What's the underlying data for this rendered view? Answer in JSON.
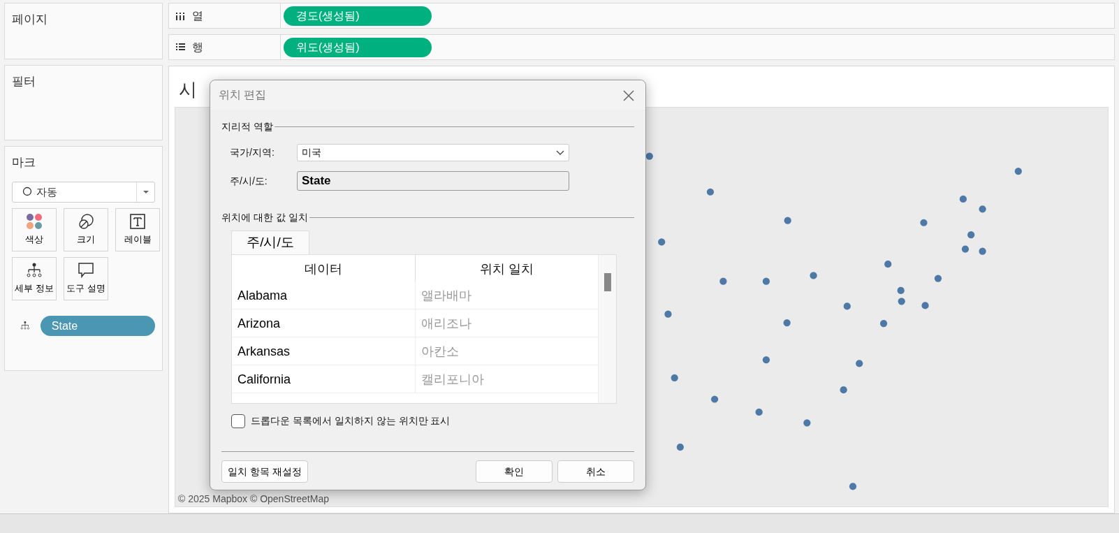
{
  "side_panels": [
    {
      "title": "페이지"
    },
    {
      "title": "필터"
    }
  ],
  "marks": {
    "title": "마크",
    "mark_type": "자동",
    "cards": [
      {
        "kind": "color",
        "label": "색상"
      },
      {
        "kind": "size",
        "label": "크기"
      },
      {
        "kind": "label",
        "label": "레이블"
      },
      {
        "kind": "detail",
        "label": "세부 정보"
      },
      {
        "kind": "tooltip",
        "label": "도구 설명"
      }
    ],
    "pills": [
      {
        "kind": "detail",
        "label": "State"
      }
    ]
  },
  "shelves": [
    {
      "kind": "columns",
      "label": "열",
      "pill": "경도(생성됨)"
    },
    {
      "kind": "rows",
      "label": "행",
      "pill": "위도(생성됨)"
    }
  ],
  "view": {
    "title": "시",
    "attribution": "© 2025 Mapbox © OpenStreetMap"
  },
  "dialog": {
    "title": "위치 편집",
    "geo_section": "지리적 역할",
    "country_label": "국가/지역:",
    "country_value": "미국",
    "state_label": "주/시/도:",
    "state_value": "State",
    "match_section": "위치에 대한 값 일치",
    "tabs": [
      {
        "label": "주/시/도",
        "selected": true
      }
    ],
    "columns": [
      "데이터",
      "위치 일치"
    ],
    "rows": [
      {
        "data": "Alabama",
        "match": "앨라배마"
      },
      {
        "data": "Arizona",
        "match": "애리조나"
      },
      {
        "data": "Arkansas",
        "match": "아칸소"
      },
      {
        "data": "California",
        "match": "캘리포니아"
      }
    ],
    "unmatched_only": {
      "label": "드롭다운 목록에서 일치하지 않는 위치만 표시",
      "checked": false
    },
    "buttons": [
      {
        "kind": "reset",
        "label": "일치 항목 재설정"
      },
      {
        "kind": "ok",
        "label": "확인"
      },
      {
        "kind": "cancel",
        "label": "취소"
      }
    ]
  }
}
